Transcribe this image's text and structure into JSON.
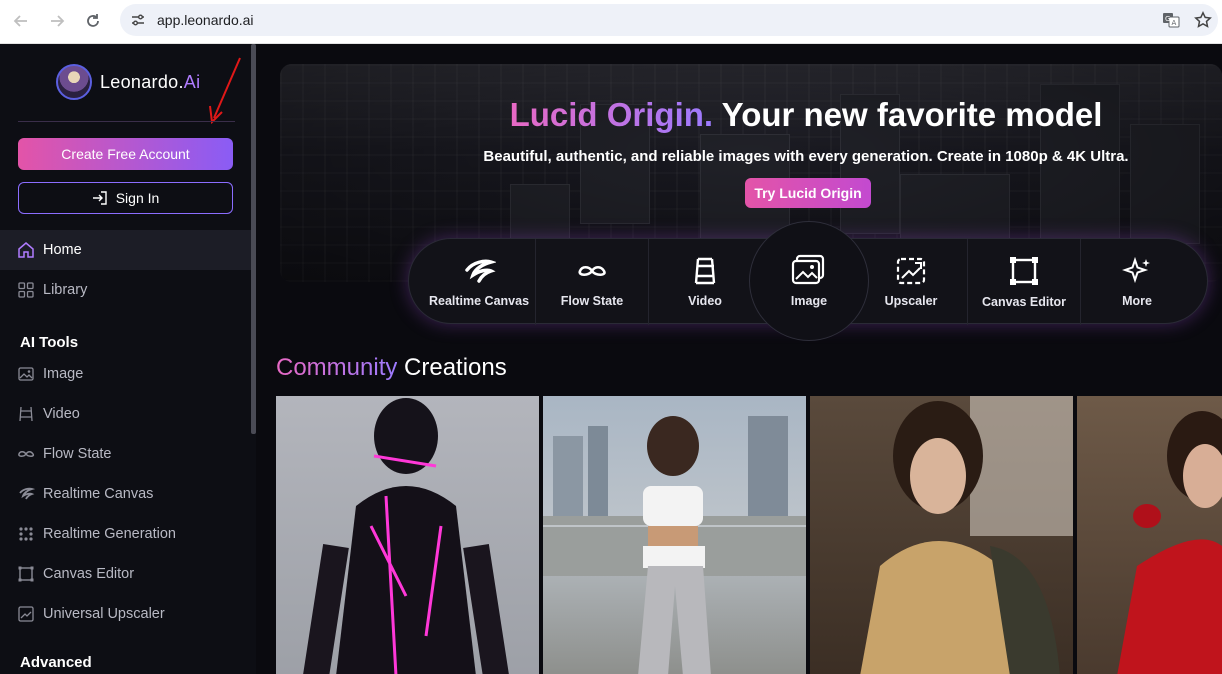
{
  "browser": {
    "url": "app.leonardo.ai"
  },
  "sidebar": {
    "logo_text": "Leonardo.",
    "logo_accent": "Ai",
    "create_account": "Create Free Account",
    "sign_in": "Sign In",
    "items": [
      {
        "label": "Home",
        "icon": "home-icon"
      },
      {
        "label": "Library",
        "icon": "grid-icon"
      }
    ],
    "ai_tools_title": "AI Tools",
    "ai_tools": [
      {
        "label": "Image",
        "icon": "image-icon"
      },
      {
        "label": "Video",
        "icon": "film-icon"
      },
      {
        "label": "Flow State",
        "icon": "infinity-icon"
      },
      {
        "label": "Realtime Canvas",
        "icon": "brush-icon"
      },
      {
        "label": "Realtime Generation",
        "icon": "dots-icon"
      },
      {
        "label": "Canvas Editor",
        "icon": "canvas-icon"
      },
      {
        "label": "Universal Upscaler",
        "icon": "upscale-icon"
      }
    ],
    "advanced_title": "Advanced"
  },
  "hero": {
    "title_accent": "Lucid Origin.",
    "title_rest": " Your new favorite model",
    "subtitle": "Beautiful, authentic, and reliable images with every generation. Create in 1080p & 4K Ultra.",
    "cta": "Try Lucid Origin"
  },
  "tools": [
    {
      "label": "Realtime Canvas",
      "icon": "brush-icon"
    },
    {
      "label": "Flow State",
      "icon": "infinity-icon"
    },
    {
      "label": "Video",
      "icon": "film-icon"
    },
    {
      "label": "Image",
      "icon": "image-icon"
    },
    {
      "label": "Upscaler",
      "icon": "upscale-icon"
    },
    {
      "label": "Canvas Editor",
      "icon": "canvas-icon"
    },
    {
      "label": "More",
      "icon": "sparkle-icon"
    }
  ],
  "community": {
    "accent": "Community",
    "rest": " Creations"
  },
  "colors": {
    "accent_pink": "#e354a8",
    "accent_purple": "#8a5cf5"
  }
}
